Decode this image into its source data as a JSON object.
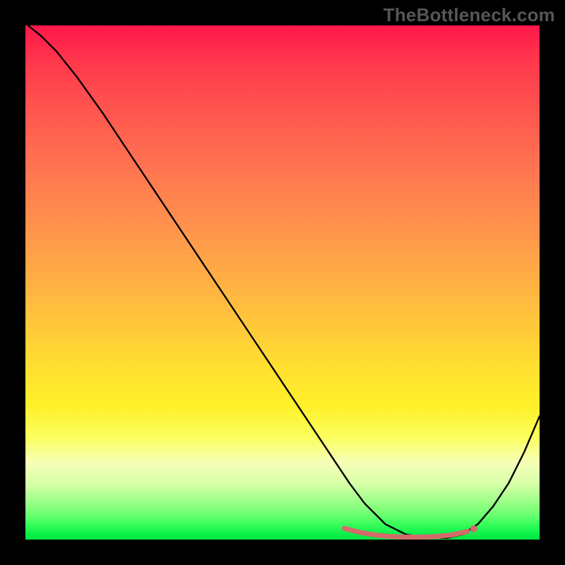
{
  "watermark": "TheBottleneck.com",
  "colors": {
    "background": "#000000",
    "curve": "#000000",
    "marker": "#d46a6a",
    "gradient_top": "#ff174a",
    "gradient_bottom": "#00e646"
  },
  "chart_data": {
    "type": "line",
    "title": "",
    "xlabel": "",
    "ylabel": "",
    "xlim": [
      0,
      100
    ],
    "ylim": [
      0,
      100
    ],
    "series": [
      {
        "name": "curve",
        "x": [
          0.5,
          3,
          6,
          10,
          15,
          20,
          25,
          30,
          35,
          40,
          45,
          50,
          55,
          60,
          63,
          66,
          70,
          74,
          78,
          82,
          85,
          88,
          91,
          94,
          97,
          100
        ],
        "y": [
          100,
          98,
          95,
          90,
          83,
          75.5,
          68,
          60.5,
          53,
          45.5,
          38,
          30.5,
          23,
          15.5,
          11,
          7,
          3,
          1,
          0.3,
          0.3,
          1,
          3,
          6.5,
          11,
          17,
          24
        ]
      }
    ],
    "markers": {
      "name": "highlight-band",
      "x": [
        62,
        65,
        68,
        71,
        74,
        77,
        80,
        83,
        86
      ],
      "y": [
        2.2,
        1.4,
        0.9,
        0.6,
        0.5,
        0.5,
        0.6,
        0.9,
        1.6
      ]
    },
    "marker_end_dot": {
      "x": 87.2,
      "y": 2.1
    }
  }
}
